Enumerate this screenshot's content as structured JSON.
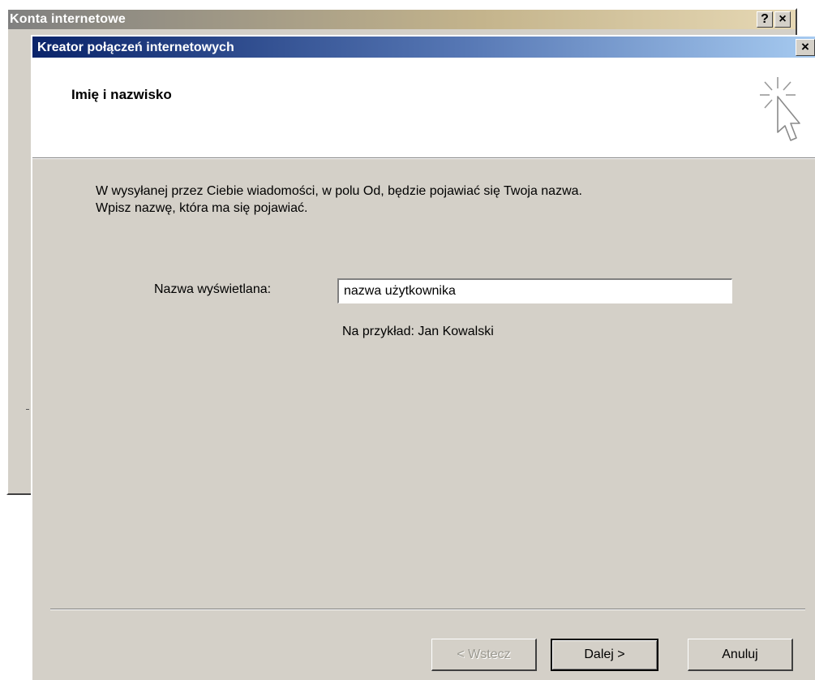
{
  "background_window": {
    "title": "Konta internetowe",
    "help_label": "?",
    "close_label": "×"
  },
  "wizard": {
    "title": "Kreator połączeń internetowych",
    "close_label": "×",
    "header_title": "Imię i nazwisko",
    "description_lines": [
      "W wysyłanej przez Ciebie wiadomości, w polu Od, będzie pojawiać się Twoja nazwa.",
      "Wpisz nazwę, która ma się pojawiać."
    ],
    "field": {
      "label": "Nazwa wyświetlana:",
      "value": "nazwa użytkownika",
      "example": "Na przykład: Jan Kowalski"
    },
    "buttons": {
      "back": "< Wstecz",
      "next": "Dalej >",
      "cancel": "Anuluj"
    }
  },
  "colors": {
    "titlebar_active": "#0a246a",
    "window_face": "#d4d0c8"
  },
  "icons": {
    "wizard_icon": "wizard-cursor-sparkle-icon"
  }
}
